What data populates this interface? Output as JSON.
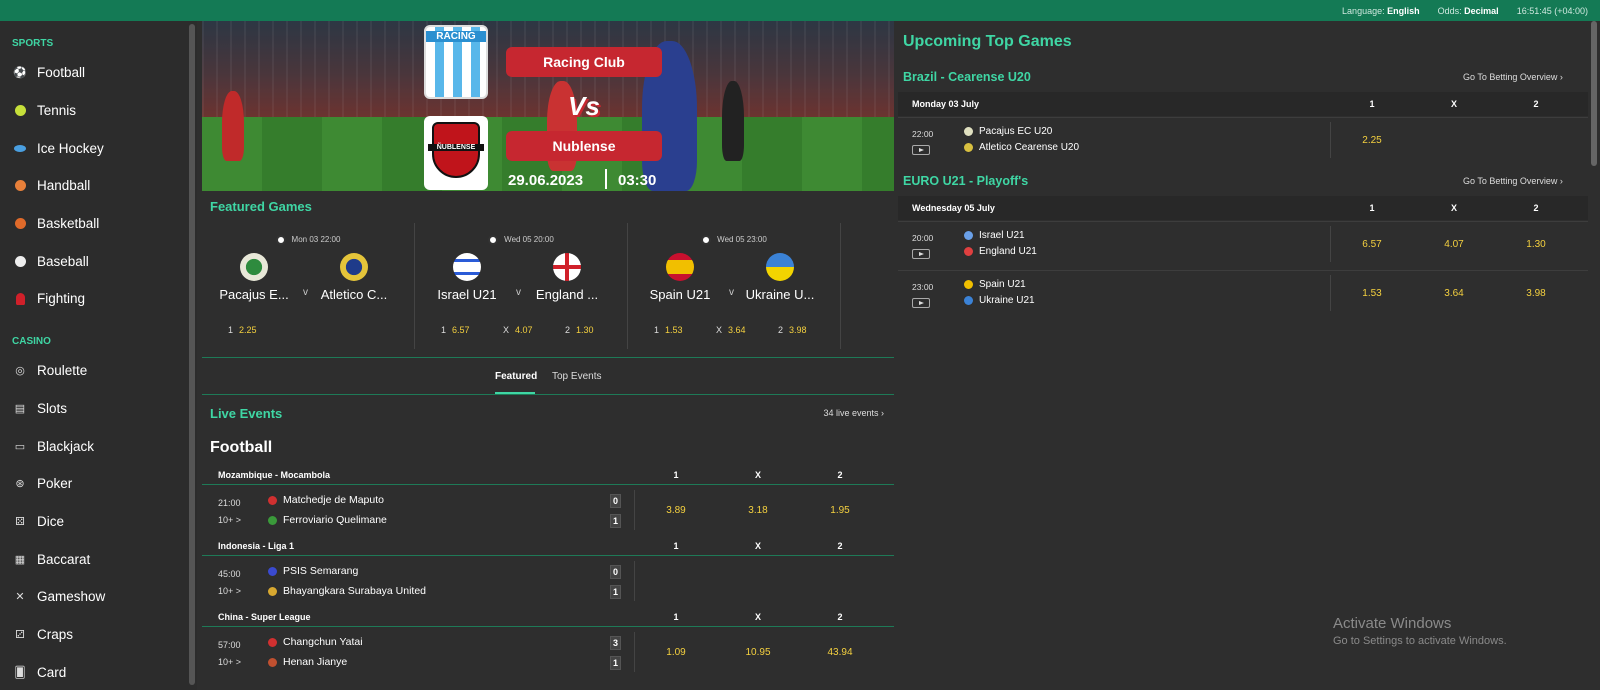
{
  "topbar": {
    "language_label": "Language:",
    "language_value": "English",
    "odds_label": "Odds:",
    "odds_value": "Decimal",
    "clock": "16:51:45 (+04:00)"
  },
  "sidebar": {
    "sports_heading": "SPORTS",
    "sports": [
      {
        "label": "Football",
        "icon": "football-icon"
      },
      {
        "label": "Tennis",
        "icon": "tennis-icon"
      },
      {
        "label": "Ice Hockey",
        "icon": "ice-hockey-icon"
      },
      {
        "label": "Handball",
        "icon": "handball-icon"
      },
      {
        "label": "Basketball",
        "icon": "basketball-icon"
      },
      {
        "label": "Baseball",
        "icon": "baseball-icon"
      },
      {
        "label": "Fighting",
        "icon": "fighting-glove-icon"
      }
    ],
    "casino_heading": "CASINO",
    "casino": [
      {
        "label": "Roulette",
        "icon": "roulette-icon"
      },
      {
        "label": "Slots",
        "icon": "slots-icon"
      },
      {
        "label": "Blackjack",
        "icon": "blackjack-icon"
      },
      {
        "label": "Poker",
        "icon": "poker-chip-icon"
      },
      {
        "label": "Dice",
        "icon": "dice-icon"
      },
      {
        "label": "Baccarat",
        "icon": "baccarat-icon"
      },
      {
        "label": "Gameshow",
        "icon": "gameshow-icon"
      },
      {
        "label": "Craps",
        "icon": "craps-icon"
      },
      {
        "label": "Card",
        "icon": "card-icon"
      }
    ]
  },
  "banner": {
    "home_logo_text": "RACING",
    "away_logo_text": "ÑUBLENSE",
    "home_team": "Racing Club",
    "away_team": "Nublense",
    "vs": "Vs",
    "date": "29.06.2023",
    "time": "03:30"
  },
  "featured": {
    "title": "Featured Games",
    "games": [
      {
        "datetime": "Mon 03 22:00",
        "home": "Pacajus E...",
        "away": "Atletico C...",
        "v": "v",
        "odds": [
          {
            "k": "1",
            "v": "2.25"
          }
        ]
      },
      {
        "datetime": "Wed 05 20:00",
        "home": "Israel U21",
        "away": "England ...",
        "v": "v",
        "odds": [
          {
            "k": "1",
            "v": "6.57"
          },
          {
            "k": "X",
            "v": "4.07"
          },
          {
            "k": "2",
            "v": "1.30"
          }
        ]
      },
      {
        "datetime": "Wed 05 23:00",
        "home": "Spain U21",
        "away": "Ukraine U...",
        "v": "v",
        "odds": [
          {
            "k": "1",
            "v": "1.53"
          },
          {
            "k": "X",
            "v": "3.64"
          },
          {
            "k": "2",
            "v": "3.98"
          }
        ]
      }
    ]
  },
  "tabs": {
    "featured": "Featured",
    "top_events": "Top Events"
  },
  "live": {
    "title": "Live Events",
    "count_link": "34 live events",
    "sport": "Football",
    "leagues": [
      {
        "name": "Mozambique - Mocambola",
        "h1": "1",
        "hx": "X",
        "h2": "2",
        "event": {
          "time": "21:00",
          "more": "10+ >",
          "home": "Matchedje de Maputo",
          "away": "Ferroviario Quelimane",
          "home_score": "0",
          "away_score": "1",
          "o1": "3.89",
          "ox": "3.18",
          "o2": "1.95"
        }
      },
      {
        "name": "Indonesia - Liga 1",
        "h1": "1",
        "hx": "X",
        "h2": "2",
        "event": {
          "time": "45:00",
          "more": "10+ >",
          "home": "PSIS Semarang",
          "away": "Bhayangkara Surabaya United",
          "home_score": "0",
          "away_score": "1",
          "o1": "",
          "ox": "",
          "o2": ""
        }
      },
      {
        "name": "China - Super League",
        "h1": "1",
        "hx": "X",
        "h2": "2",
        "event": {
          "time": "57:00",
          "more": "10+ >",
          "home": "Changchun Yatai",
          "away": "Henan Jianye",
          "home_score": "3",
          "away_score": "1",
          "o1": "1.09",
          "ox": "10.95",
          "o2": "43.94"
        }
      }
    ]
  },
  "upcoming": {
    "title": "Upcoming Top Games",
    "link_label": "Go To Betting Overview",
    "groups": [
      {
        "league": "Brazil - Cearense U20",
        "day": "Monday 03 July",
        "h1": "1",
        "hx": "X",
        "h2": "2",
        "events": [
          {
            "time": "22:00",
            "home": "Pacajus EC U20",
            "away": "Atletico Cearense U20",
            "o1": "2.25",
            "ox": "",
            "o2": ""
          }
        ]
      },
      {
        "league": "EURO U21 - Playoff's",
        "day": "Wednesday 05 July",
        "h1": "1",
        "hx": "X",
        "h2": "2",
        "events": [
          {
            "time": "20:00",
            "home": "Israel U21",
            "away": "England U21",
            "o1": "6.57",
            "ox": "4.07",
            "o2": "1.30"
          },
          {
            "time": "23:00",
            "home": "Spain U21",
            "away": "Ukraine U21",
            "o1": "1.53",
            "ox": "3.64",
            "o2": "3.98"
          }
        ]
      }
    ]
  },
  "watermark": {
    "line1": "Activate Windows",
    "line2": "Go to Settings to activate Windows."
  },
  "colors": {
    "accent": "#3fd6a4",
    "topbar": "#147a55",
    "odds": "#f4d03f",
    "background": "#2e2e2e",
    "pill": "#c62730"
  }
}
